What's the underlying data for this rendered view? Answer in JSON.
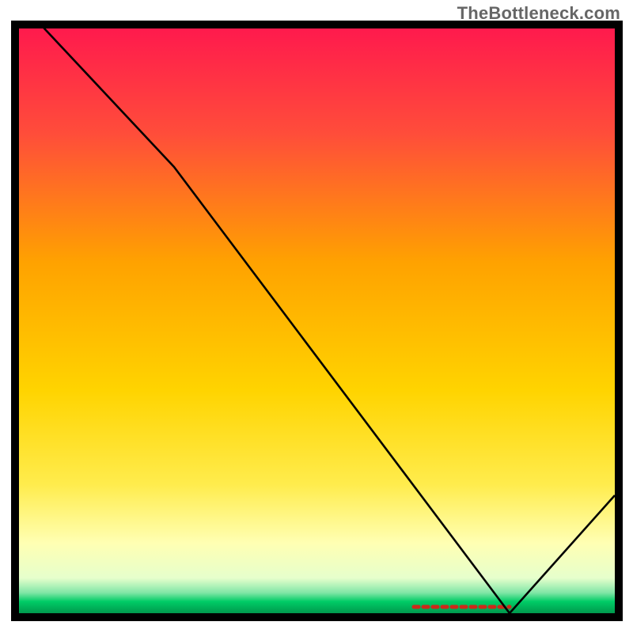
{
  "watermark": "TheBottleneck.com",
  "chart_data": {
    "type": "line",
    "title": "",
    "xlabel": "",
    "ylabel": "",
    "xlim": [
      0,
      100
    ],
    "ylim": [
      0,
      100
    ],
    "grid": false,
    "x": [
      0,
      4,
      26,
      82,
      100
    ],
    "values": [
      105,
      100,
      76,
      0,
      20
    ],
    "background_gradient": {
      "top": "#ff1a4d",
      "mid_upper": "#ffa200",
      "mid_lower": "#ffe600",
      "pale": "#ffffb3",
      "green": "#00cc66"
    },
    "annotation": {
      "label": "",
      "color": "#cc2a1a",
      "x_range": [
        66,
        82
      ]
    },
    "border_color": "#000000"
  }
}
